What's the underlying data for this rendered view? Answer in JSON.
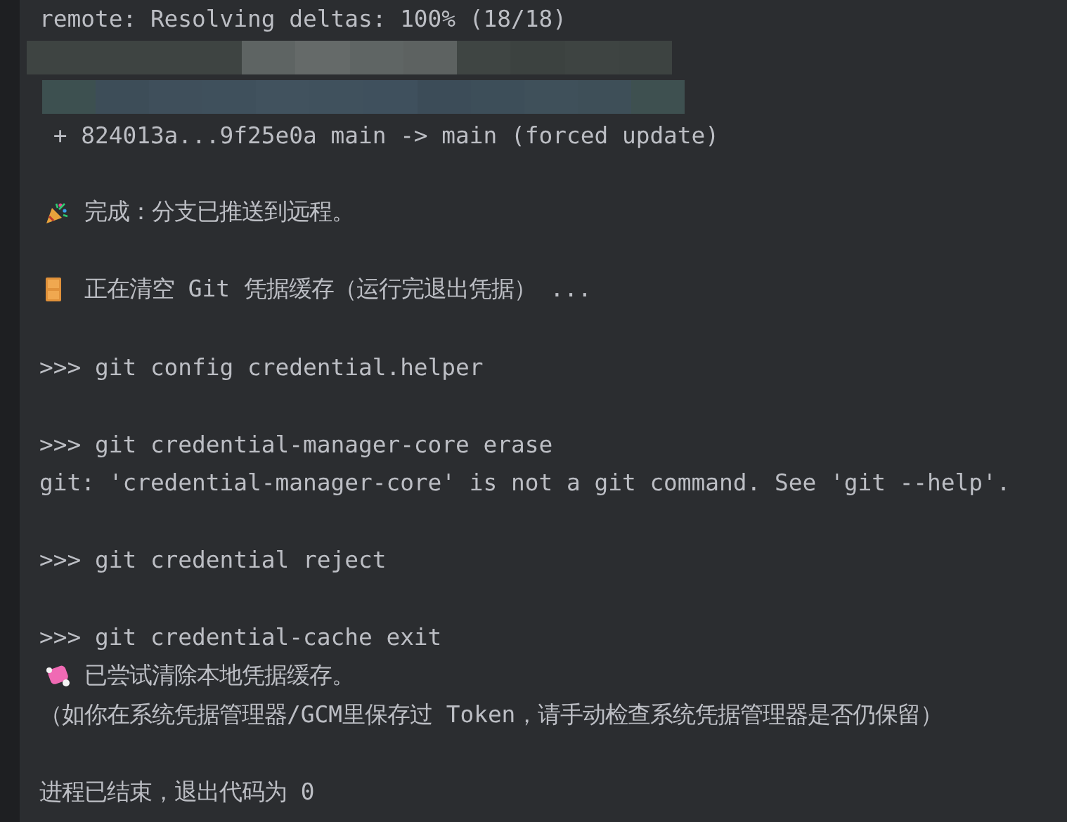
{
  "terminal": {
    "lines": [
      {
        "kind": "output",
        "text": "remote: Resolving deltas: 100% (18/18)"
      },
      {
        "kind": "redacted"
      },
      {
        "kind": "redacted"
      },
      {
        "kind": "output",
        "text": " + 824013a...9f25e0a main -> main (forced update)"
      },
      {
        "kind": "blank"
      },
      {
        "kind": "success",
        "text": "完成：分支已推送到远程。"
      },
      {
        "kind": "blank"
      },
      {
        "kind": "pending",
        "text": "正在清空 Git 凭据缓存（运行完退出凭据） ..."
      },
      {
        "kind": "blank"
      },
      {
        "kind": "command",
        "text": ">>> git config credential.helper"
      },
      {
        "kind": "blank"
      },
      {
        "kind": "command",
        "text": ">>> git credential-manager-core erase"
      },
      {
        "kind": "output",
        "text": "git: 'credential-manager-core' is not a git command. See 'git --help'."
      },
      {
        "kind": "blank"
      },
      {
        "kind": "command",
        "text": ">>> git credential reject"
      },
      {
        "kind": "blank"
      },
      {
        "kind": "command",
        "text": ">>> git credential-cache exit"
      },
      {
        "kind": "done",
        "text": "已尝试清除本地凭据缓存。"
      },
      {
        "kind": "output",
        "text": "（如你在系统凭据管理器/GCM里保存过 Token，请手动检查系统凭据管理器是否仍保留）"
      },
      {
        "kind": "blank"
      },
      {
        "kind": "output",
        "text": "进程已结束，退出代码为 0"
      }
    ]
  }
}
